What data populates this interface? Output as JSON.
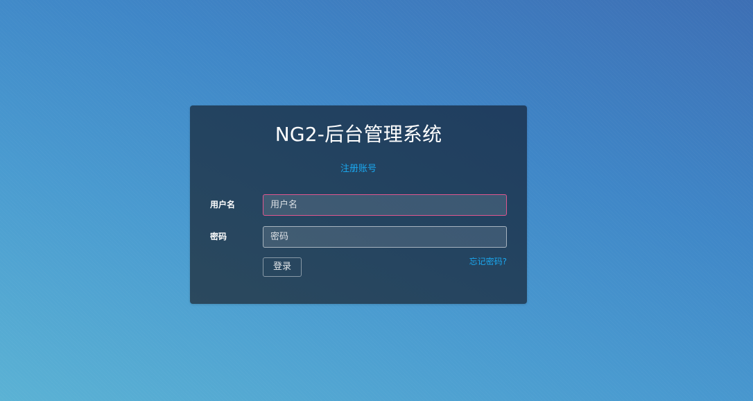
{
  "login_form": {
    "title": "NG2-后台管理系统",
    "register_link": "注册账号",
    "username": {
      "label": "用户名",
      "placeholder": "用户名",
      "value": ""
    },
    "password": {
      "label": "密码",
      "placeholder": "密码",
      "value": ""
    },
    "login_button": "登录",
    "forgot_password_link": "忘记密码?"
  },
  "colors": {
    "link": "#1aa7ee",
    "focused_border": "#e0578f"
  }
}
